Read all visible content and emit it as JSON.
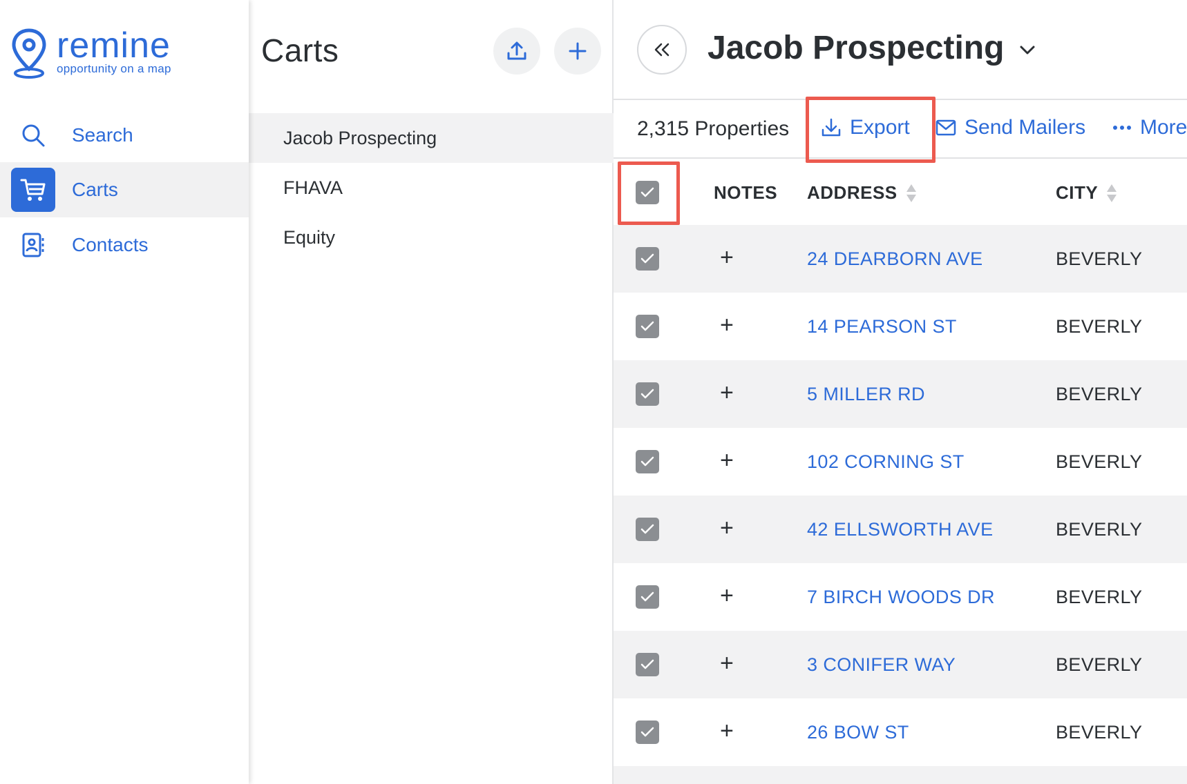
{
  "brand": {
    "name": "remine",
    "tagline": "opportunity on a map",
    "color": "#2d6bd8"
  },
  "nav": {
    "items": [
      {
        "label": "Search",
        "icon": "search-icon",
        "active": false
      },
      {
        "label": "Carts",
        "icon": "cart-icon",
        "active": true
      },
      {
        "label": "Contacts",
        "icon": "contacts-icon",
        "active": false
      }
    ]
  },
  "carts_panel": {
    "title": "Carts",
    "upload_icon": "upload-icon",
    "add_icon": "plus-icon",
    "items": [
      {
        "label": "Jacob Prospecting",
        "selected": true
      },
      {
        "label": "FHAVA",
        "selected": false
      },
      {
        "label": "Equity",
        "selected": false
      }
    ]
  },
  "main": {
    "title": "Jacob Prospecting",
    "collapse_icon": "double-chevron-left-icon",
    "toolbar": {
      "count": "2,315 Properties",
      "export_label": "Export",
      "send_mailers_label": "Send Mailers",
      "more_label": "More"
    },
    "table": {
      "columns": [
        "NOTES",
        "ADDRESS",
        "CITY"
      ],
      "header_checked": true,
      "rows": [
        {
          "address": "24 DEARBORN AVE",
          "city": "BEVERLY",
          "checked": true
        },
        {
          "address": "14 PEARSON ST",
          "city": "BEVERLY",
          "checked": true
        },
        {
          "address": "5 MILLER RD",
          "city": "BEVERLY",
          "checked": true
        },
        {
          "address": "102 CORNING ST",
          "city": "BEVERLY",
          "checked": true
        },
        {
          "address": "42 ELLSWORTH AVE",
          "city": "BEVERLY",
          "checked": true
        },
        {
          "address": "7 BIRCH WOODS DR",
          "city": "BEVERLY",
          "checked": true
        },
        {
          "address": "3 CONIFER WAY",
          "city": "BEVERLY",
          "checked": true
        },
        {
          "address": "26 BOW ST",
          "city": "BEVERLY",
          "checked": true
        }
      ],
      "note_add_glyph": "+"
    }
  },
  "colors": {
    "accent": "#2d6bd8",
    "highlight": "#ec5a4f",
    "checkbox": "#8b8e92",
    "row_alt": "#f2f2f3"
  }
}
